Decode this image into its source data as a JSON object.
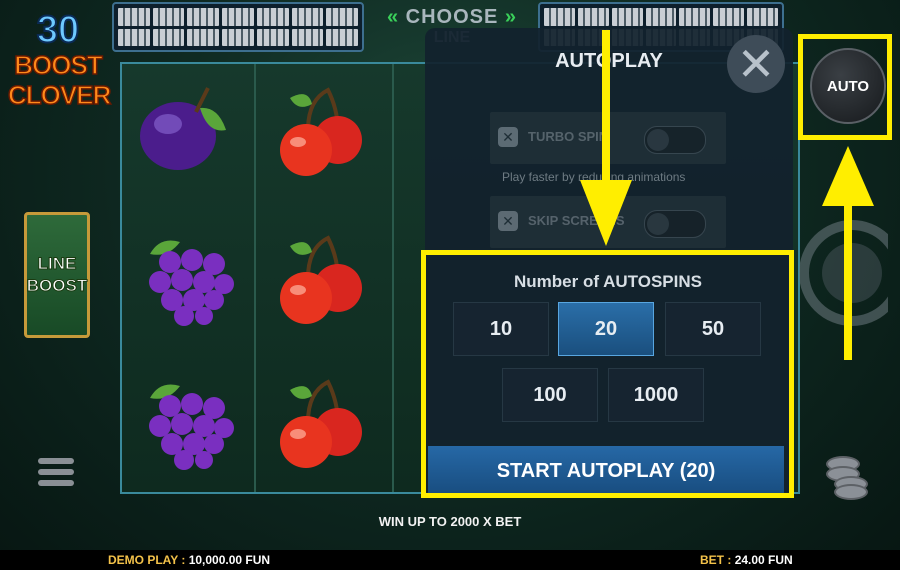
{
  "logo": {
    "number": "30",
    "line1": "BOOST",
    "line2": "CLOVER"
  },
  "feature": {
    "line1": "LINE",
    "line2": "BOOST"
  },
  "header": {
    "choose_top": "CHOOSE",
    "choose_bottom": "LINE"
  },
  "reels": {
    "symbols": [
      "plum",
      "cherry",
      "grapes",
      "cherry",
      "grapes",
      "cherry"
    ]
  },
  "autoplay_panel": {
    "title": "AUTOPLAY",
    "turbo_label": "TURBO SPIN",
    "turbo_desc": "Play faster by reducing animations",
    "skip_label": "SKIP SCREENS",
    "autospins_label": "Number of AUTOSPINS",
    "options": [
      "10",
      "20",
      "50",
      "100",
      "1000"
    ],
    "selected": "20",
    "start_label": "START AUTOPLAY (20)"
  },
  "auto_button": {
    "label": "AUTO"
  },
  "win_up": "WIN UP TO 2000 X BET",
  "footer": {
    "demo_label": "DEMO PLAY :",
    "demo_value": "10,000.00 FUN",
    "bet_label": "BET :",
    "bet_value": "24.00 FUN"
  },
  "colors": {
    "highlight": "#ffee00",
    "selected": "#2a6ea8",
    "start": "#2668a6"
  },
  "icons": [
    "close-icon",
    "menu-icon",
    "coins-icon",
    "auto-icon",
    "spin-icon"
  ]
}
